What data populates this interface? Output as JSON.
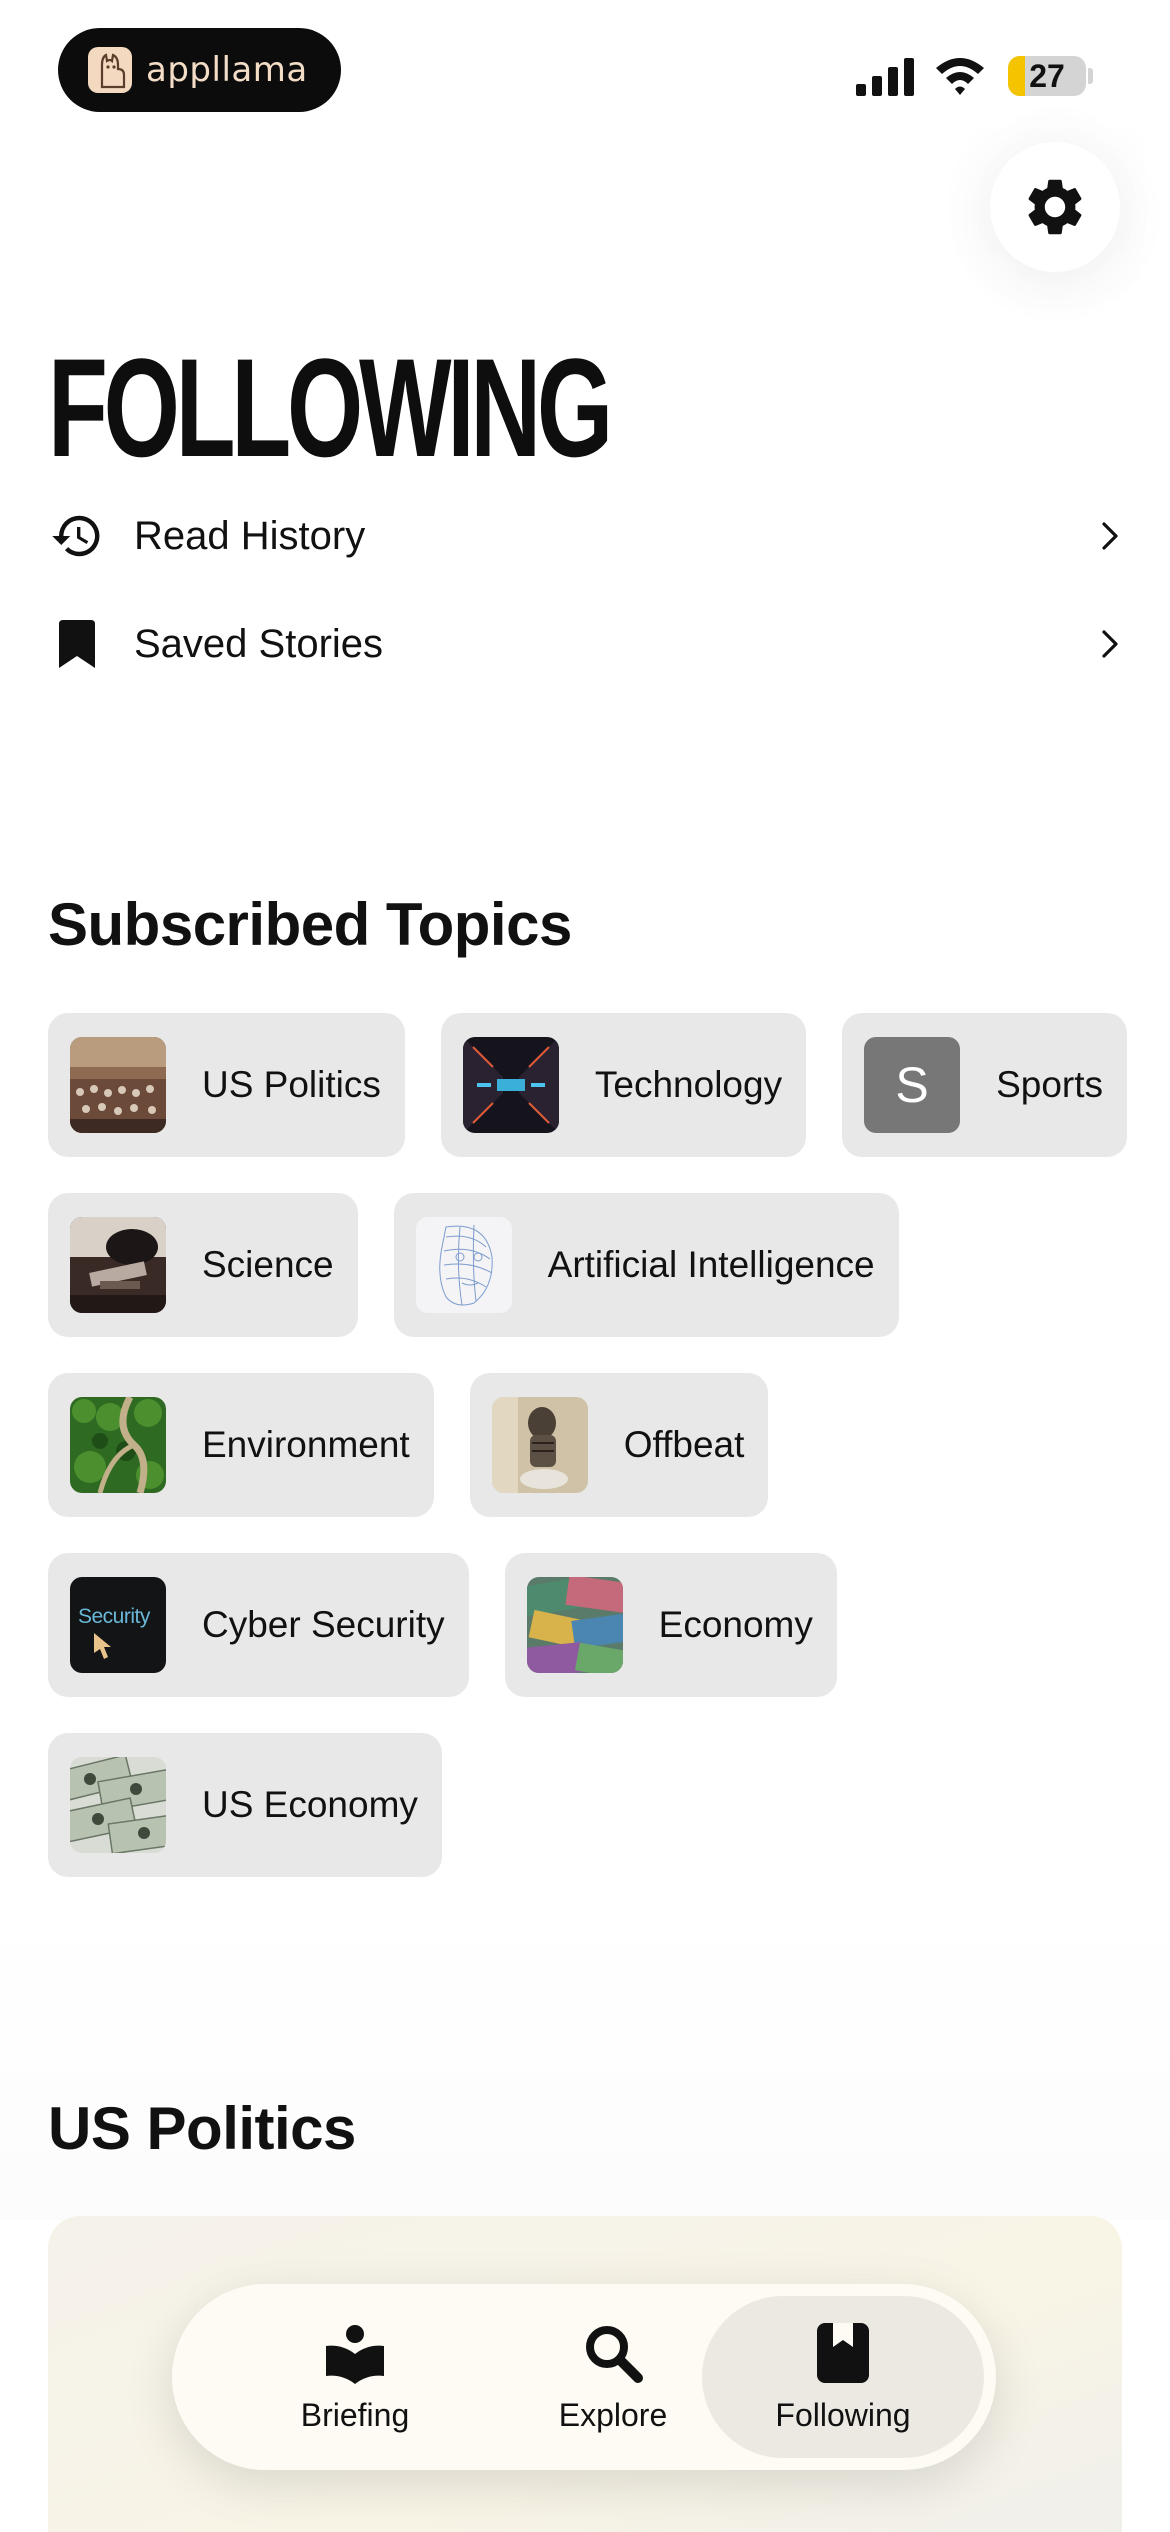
{
  "status_bar": {
    "app_badge_text": "appllama",
    "battery_level": "27",
    "battery_fraction": 0.22
  },
  "header": {
    "title": "FOLLOWING",
    "settings_icon": "gear-icon"
  },
  "menu": [
    {
      "label": "Read History",
      "icon": "history-icon"
    },
    {
      "label": "Saved Stories",
      "icon": "bookmark-icon"
    }
  ],
  "subscribed": {
    "title": "Subscribed Topics",
    "topics": [
      {
        "label": "US Politics",
        "thumb": "congress-photo"
      },
      {
        "label": "Technology",
        "thumb": "tech-photo"
      },
      {
        "label": "Sports",
        "thumb": "letter-s",
        "letter": "S"
      },
      {
        "label": "Science",
        "thumb": "microscope-photo"
      },
      {
        "label": "Artificial Intelligence",
        "thumb": "wireframe-face"
      },
      {
        "label": "Environment",
        "thumb": "forest-photo"
      },
      {
        "label": "Offbeat",
        "thumb": "robot-photo"
      },
      {
        "label": "Cyber Security",
        "thumb": "security-screen",
        "thumb_text": "Security"
      },
      {
        "label": "Economy",
        "thumb": "banknotes-photo"
      },
      {
        "label": "US Economy",
        "thumb": "dollars-photo"
      }
    ]
  },
  "section": {
    "title": "US Politics"
  },
  "tabs": [
    {
      "label": "Briefing",
      "icon": "open-book-reader-icon",
      "active": false
    },
    {
      "label": "Explore",
      "icon": "search-icon",
      "active": false
    },
    {
      "label": "Following",
      "icon": "bookmark-book-icon",
      "active": true
    }
  ],
  "colors": {
    "chip_bg": "#e8e8e8",
    "battery_fill": "#f5c400",
    "tabbar_bg": "#fdfbf4"
  }
}
